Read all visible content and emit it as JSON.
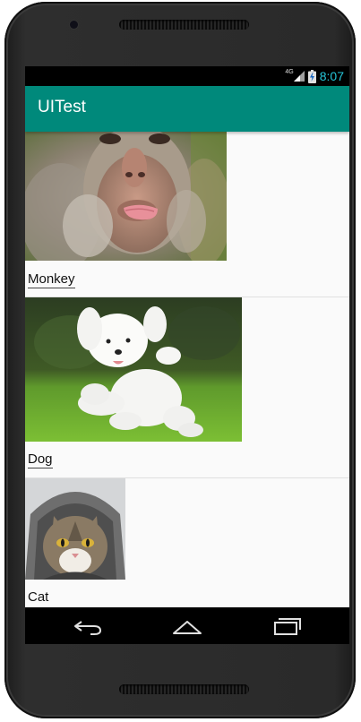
{
  "status_bar": {
    "network": "4G",
    "time": "8:07",
    "accent_color": "#26c6da"
  },
  "app_bar": {
    "title": "UITest",
    "color": "#00897b"
  },
  "list": {
    "items": [
      {
        "label": "Monkey",
        "image": "monkey-photo"
      },
      {
        "label": "Dog",
        "image": "dog-photo"
      },
      {
        "label": "Cat",
        "image": "cat-photo"
      }
    ]
  },
  "nav_bar": {
    "buttons": [
      {
        "icon": "back-icon"
      },
      {
        "icon": "home-icon"
      },
      {
        "icon": "recents-icon"
      }
    ]
  }
}
